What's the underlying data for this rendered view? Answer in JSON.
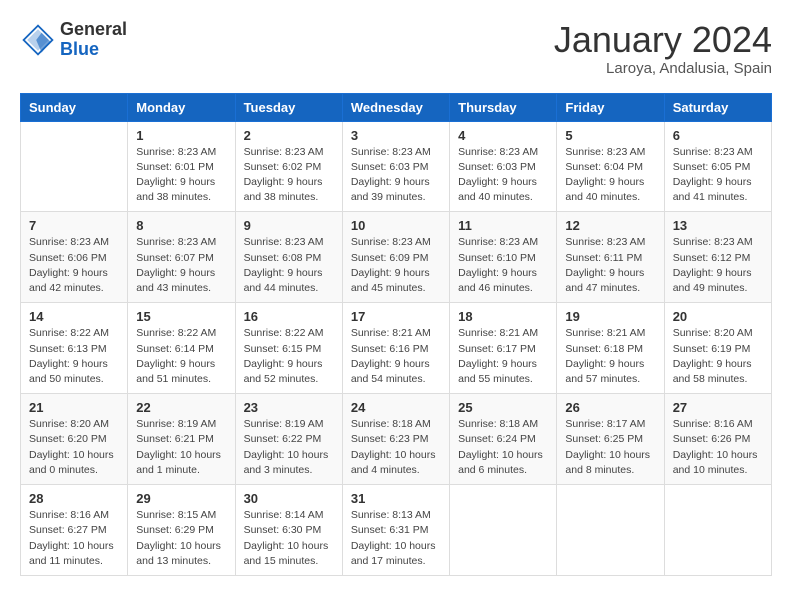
{
  "header": {
    "logo_general": "General",
    "logo_blue": "Blue",
    "month_title": "January 2024",
    "subtitle": "Laroya, Andalusia, Spain"
  },
  "weekdays": [
    "Sunday",
    "Monday",
    "Tuesday",
    "Wednesday",
    "Thursday",
    "Friday",
    "Saturday"
  ],
  "weeks": [
    [
      {
        "day": "",
        "info": ""
      },
      {
        "day": "1",
        "info": "Sunrise: 8:23 AM\nSunset: 6:01 PM\nDaylight: 9 hours\nand 38 minutes."
      },
      {
        "day": "2",
        "info": "Sunrise: 8:23 AM\nSunset: 6:02 PM\nDaylight: 9 hours\nand 38 minutes."
      },
      {
        "day": "3",
        "info": "Sunrise: 8:23 AM\nSunset: 6:03 PM\nDaylight: 9 hours\nand 39 minutes."
      },
      {
        "day": "4",
        "info": "Sunrise: 8:23 AM\nSunset: 6:03 PM\nDaylight: 9 hours\nand 40 minutes."
      },
      {
        "day": "5",
        "info": "Sunrise: 8:23 AM\nSunset: 6:04 PM\nDaylight: 9 hours\nand 40 minutes."
      },
      {
        "day": "6",
        "info": "Sunrise: 8:23 AM\nSunset: 6:05 PM\nDaylight: 9 hours\nand 41 minutes."
      }
    ],
    [
      {
        "day": "7",
        "info": "Sunrise: 8:23 AM\nSunset: 6:06 PM\nDaylight: 9 hours\nand 42 minutes."
      },
      {
        "day": "8",
        "info": "Sunrise: 8:23 AM\nSunset: 6:07 PM\nDaylight: 9 hours\nand 43 minutes."
      },
      {
        "day": "9",
        "info": "Sunrise: 8:23 AM\nSunset: 6:08 PM\nDaylight: 9 hours\nand 44 minutes."
      },
      {
        "day": "10",
        "info": "Sunrise: 8:23 AM\nSunset: 6:09 PM\nDaylight: 9 hours\nand 45 minutes."
      },
      {
        "day": "11",
        "info": "Sunrise: 8:23 AM\nSunset: 6:10 PM\nDaylight: 9 hours\nand 46 minutes."
      },
      {
        "day": "12",
        "info": "Sunrise: 8:23 AM\nSunset: 6:11 PM\nDaylight: 9 hours\nand 47 minutes."
      },
      {
        "day": "13",
        "info": "Sunrise: 8:23 AM\nSunset: 6:12 PM\nDaylight: 9 hours\nand 49 minutes."
      }
    ],
    [
      {
        "day": "14",
        "info": "Sunrise: 8:22 AM\nSunset: 6:13 PM\nDaylight: 9 hours\nand 50 minutes."
      },
      {
        "day": "15",
        "info": "Sunrise: 8:22 AM\nSunset: 6:14 PM\nDaylight: 9 hours\nand 51 minutes."
      },
      {
        "day": "16",
        "info": "Sunrise: 8:22 AM\nSunset: 6:15 PM\nDaylight: 9 hours\nand 52 minutes."
      },
      {
        "day": "17",
        "info": "Sunrise: 8:21 AM\nSunset: 6:16 PM\nDaylight: 9 hours\nand 54 minutes."
      },
      {
        "day": "18",
        "info": "Sunrise: 8:21 AM\nSunset: 6:17 PM\nDaylight: 9 hours\nand 55 minutes."
      },
      {
        "day": "19",
        "info": "Sunrise: 8:21 AM\nSunset: 6:18 PM\nDaylight: 9 hours\nand 57 minutes."
      },
      {
        "day": "20",
        "info": "Sunrise: 8:20 AM\nSunset: 6:19 PM\nDaylight: 9 hours\nand 58 minutes."
      }
    ],
    [
      {
        "day": "21",
        "info": "Sunrise: 8:20 AM\nSunset: 6:20 PM\nDaylight: 10 hours\nand 0 minutes."
      },
      {
        "day": "22",
        "info": "Sunrise: 8:19 AM\nSunset: 6:21 PM\nDaylight: 10 hours\nand 1 minute."
      },
      {
        "day": "23",
        "info": "Sunrise: 8:19 AM\nSunset: 6:22 PM\nDaylight: 10 hours\nand 3 minutes."
      },
      {
        "day": "24",
        "info": "Sunrise: 8:18 AM\nSunset: 6:23 PM\nDaylight: 10 hours\nand 4 minutes."
      },
      {
        "day": "25",
        "info": "Sunrise: 8:18 AM\nSunset: 6:24 PM\nDaylight: 10 hours\nand 6 minutes."
      },
      {
        "day": "26",
        "info": "Sunrise: 8:17 AM\nSunset: 6:25 PM\nDaylight: 10 hours\nand 8 minutes."
      },
      {
        "day": "27",
        "info": "Sunrise: 8:16 AM\nSunset: 6:26 PM\nDaylight: 10 hours\nand 10 minutes."
      }
    ],
    [
      {
        "day": "28",
        "info": "Sunrise: 8:16 AM\nSunset: 6:27 PM\nDaylight: 10 hours\nand 11 minutes."
      },
      {
        "day": "29",
        "info": "Sunrise: 8:15 AM\nSunset: 6:29 PM\nDaylight: 10 hours\nand 13 minutes."
      },
      {
        "day": "30",
        "info": "Sunrise: 8:14 AM\nSunset: 6:30 PM\nDaylight: 10 hours\nand 15 minutes."
      },
      {
        "day": "31",
        "info": "Sunrise: 8:13 AM\nSunset: 6:31 PM\nDaylight: 10 hours\nand 17 minutes."
      },
      {
        "day": "",
        "info": ""
      },
      {
        "day": "",
        "info": ""
      },
      {
        "day": "",
        "info": ""
      }
    ]
  ]
}
